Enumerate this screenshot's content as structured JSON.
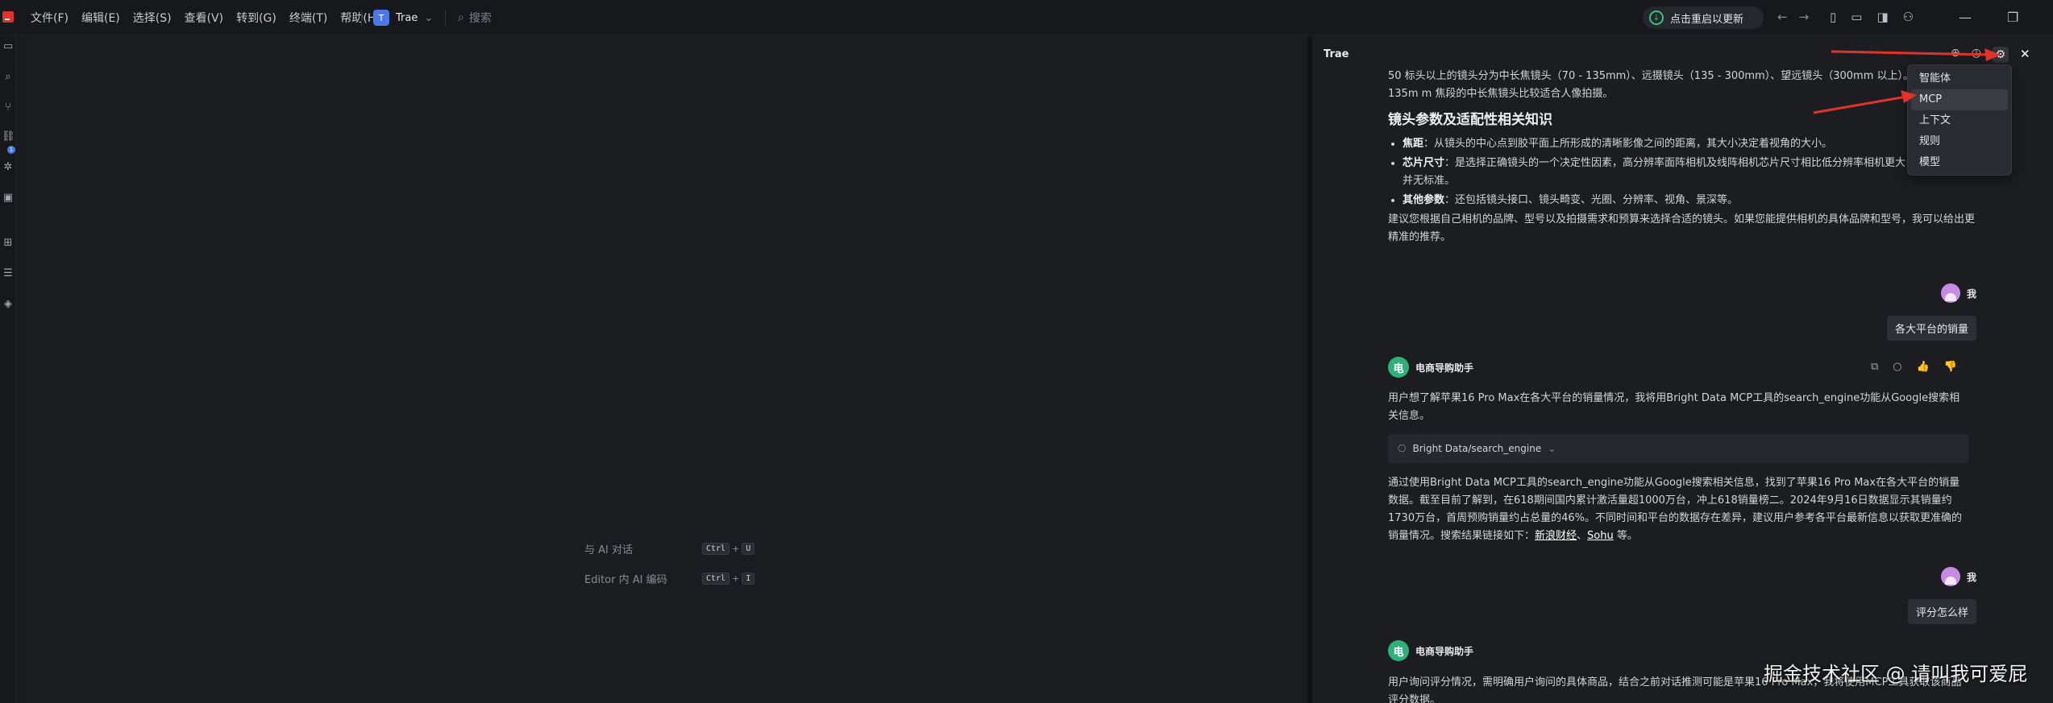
{
  "menu": [
    "文件(F)",
    "编辑(E)",
    "选择(S)",
    "查看(V)",
    "转到(G)",
    "终端(T)",
    "帮助(H)"
  ],
  "workspace": {
    "badge": "T",
    "name": "Trae",
    "chevron": "⌄"
  },
  "search": {
    "placeholder": "搜索"
  },
  "update": {
    "label": "点击重启以更新"
  },
  "editor": {
    "shortcuts": [
      {
        "label": "与 AI 对话",
        "k1": "Ctrl",
        "k2": "U"
      },
      {
        "label": "Editor 内 AI 编码",
        "k1": "Ctrl",
        "k2": "I"
      }
    ]
  },
  "panel": {
    "title": "Trae",
    "intro_line": "50 标头以上的镜头分为中长焦镜头（70 - 135mm）、远摄镜头（135 - 300mm）、望远镜头（300mm 以上）。一般 85 - 135m m 焦段的中长焦镜头比较适合人像拍摄。",
    "heading": "镜头参数及适配性相关知识",
    "bullets": [
      {
        "term": "焦距",
        "text": "：从镜头的中心点到胶平面上所形成的清晰影像之间的距离，其大小决定着视角的大小。"
      },
      {
        "term": "芯片尺寸",
        "text": "：是选择正确镜头的一个决定性因素，高分辨率面阵相机及线阵相机芯片尺寸相比低分辨率相机更大，在芯片尺寸并无标准。"
      },
      {
        "term": "其他参数",
        "text": "：还包括镜头接口、镜头畸变、光圈、分辨率、视角、景深等。"
      }
    ],
    "advice": "建议您根据自己相机的品牌、型号以及拍摄需求和预算来选择合适的镜头。如果您能提供相机的具体品牌和型号，我可以给出更精准的推荐。",
    "user_name": "我",
    "user_msg1": "各大平台的销量",
    "bot_name": "电商导购助手",
    "bot_avatar": "电",
    "bot_msg1_intro": "用户想了解苹果16 Pro Max在各大平台的销量情况，我将用Bright Data MCP工具的search_engine功能从Google搜索相关信息。",
    "tool_call": "Bright Data/search_engine",
    "bot_msg1_result": "通过使用Bright Data MCP工具的search_engine功能从Google搜索相关信息，找到了苹果16 Pro Max在各大平台的销量数据。截至目前了解到，在618期间国内累计激活量超1000万台，冲上618销量榜二。2024年9月16日数据显示其销量约1730万台，首周预购销量约占总量的46%。不同时间和平台的数据存在差异，建议用户参考各平台最新信息以获取更准确的销量情况。搜索结果链接如下：",
    "link1": "新浪财经",
    "link_sep": "、",
    "link2": "Sohu",
    "link_end": " 等。",
    "user_msg2": "评分怎么样",
    "bot_msg2_intro": "用户询问评分情况，需明确用户询问的具体商品，结合之前对话推测可能是苹果16 Pro Max，我将使用MCP工具获取该商品评分数据。"
  },
  "dropdown": {
    "items": [
      "智能体",
      "MCP",
      "上下文",
      "规则",
      "模型"
    ],
    "active": "MCP"
  },
  "watermark": "掘金技术社区 @ 请叫我可爱屁",
  "colors": {
    "accent": "#4a78e6",
    "bot_avatar": "#2fb27a",
    "arrow": "#e0322b",
    "update": "#35c08a"
  }
}
